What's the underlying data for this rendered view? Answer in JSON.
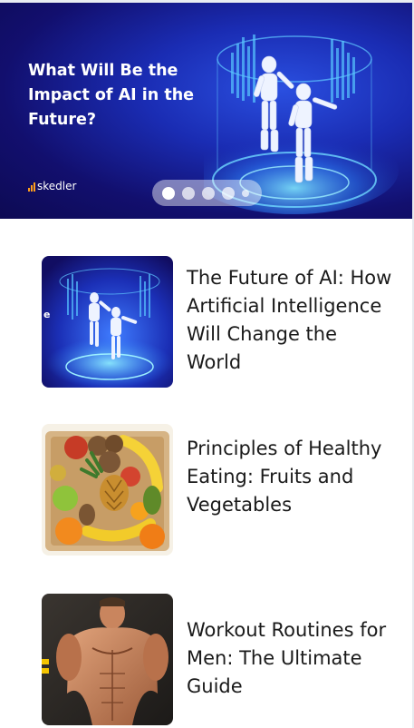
{
  "carousel": {
    "headline": "What Will Be the\nImpact of AI in the\nFuture?",
    "brand": "skedler",
    "brand_accent": "#ff9e1b",
    "slide_count": 5,
    "active_slide": 1
  },
  "articles": [
    {
      "title": "The Future of AI: How Artificial Intelligence Will Change the World",
      "thumb_letter": "e",
      "image": "ai-robots-image"
    },
    {
      "title": "Principles of Healthy Eating: Fruits and Vegetables",
      "image": "fruit-basket-image"
    },
    {
      "title": "Workout Routines for Men: The Ultimate Guide",
      "image": "muscular-man-image"
    }
  ]
}
